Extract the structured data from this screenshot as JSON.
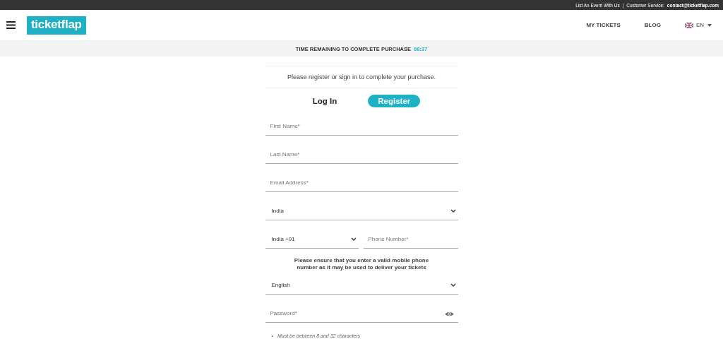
{
  "top_bar": {
    "links": [
      "List An Event With Us",
      "|",
      "Customer Service:"
    ],
    "contact": "contact@ticketflap.com"
  },
  "header": {
    "logo": "ticketflap",
    "nav": [
      "MY TICKETS",
      "BLOG"
    ],
    "language": "EN"
  },
  "timer": {
    "label": "TIME REMAINING TO COMPLETE PURCHASE",
    "time": "08:37"
  },
  "intro": "Please register or sign in to complete your purchase.",
  "tabs": [
    {
      "label": "Log In",
      "selected": false
    },
    {
      "label": "Register",
      "selected": true
    }
  ],
  "fields": [
    {
      "kind": "text",
      "placeholder": "First Name*"
    },
    {
      "kind": "text",
      "placeholder": "Last Name*"
    },
    {
      "kind": "text",
      "placeholder": "Email Address*"
    },
    {
      "kind": "select",
      "value": "India"
    },
    {
      "kind": "phone",
      "code": "India +91",
      "placeholder": "Phone Number*"
    },
    {
      "kind": "note",
      "text": "Please ensure that you enter a valid mobile phone number as it may be used to deliver your tickets"
    },
    {
      "kind": "select",
      "value": "English"
    },
    {
      "kind": "password",
      "placeholder": "Password*"
    }
  ],
  "rules": [
    {
      "marker": "•",
      "text": "Must be between 8 and 32 characters"
    }
  ]
}
